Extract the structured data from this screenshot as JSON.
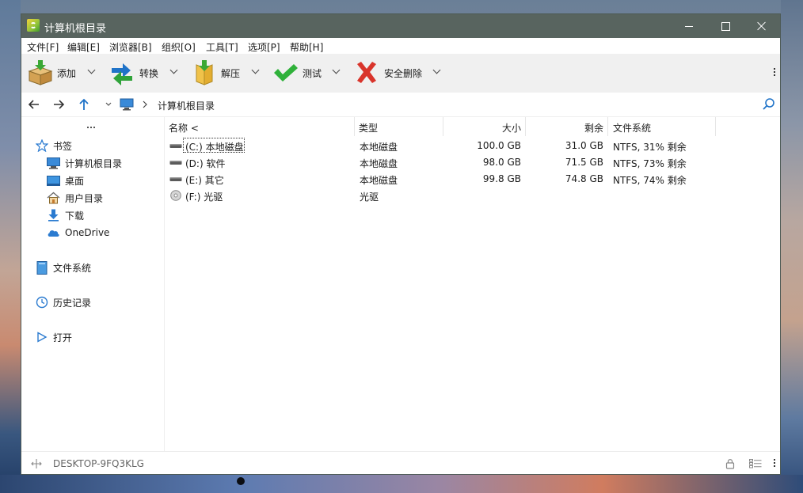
{
  "window": {
    "title": "计算机根目录"
  },
  "menu": [
    {
      "label": "文件[F]"
    },
    {
      "label": "编辑[E]"
    },
    {
      "label": "浏览器[B]"
    },
    {
      "label": "组织[O]"
    },
    {
      "label": "工具[T]"
    },
    {
      "label": "选项[P]"
    },
    {
      "label": "帮助[H]"
    }
  ],
  "toolbar": {
    "add": "添加",
    "convert": "转换",
    "extract": "解压",
    "test": "测试",
    "secure_delete": "安全删除"
  },
  "address": {
    "path": "计算机根目录"
  },
  "sidebar": {
    "bookmarks": "书签",
    "items": [
      {
        "label": "计算机根目录",
        "icon": "monitor-icon"
      },
      {
        "label": "桌面",
        "icon": "desktop-icon"
      },
      {
        "label": "用户目录",
        "icon": "home-icon"
      },
      {
        "label": "下载",
        "icon": "download-icon"
      },
      {
        "label": "OneDrive",
        "icon": "cloud-icon"
      }
    ],
    "filesystem": "文件系统",
    "history": "历史记录",
    "open": "打开"
  },
  "table": {
    "columns": {
      "name": "名称 <",
      "type": "类型",
      "size": "大小",
      "free": "剩余",
      "fs": "文件系统"
    },
    "rows": [
      {
        "name": "(C:) 本地磁盘",
        "type": "本地磁盘",
        "size": "100.0 GB",
        "free": "31.0 GB",
        "fs": "NTFS, 31% 剩余",
        "icon": "hard-drive-icon"
      },
      {
        "name": "(D:) 软件",
        "type": "本地磁盘",
        "size": "98.0 GB",
        "free": "71.5 GB",
        "fs": "NTFS, 73% 剩余",
        "icon": "hard-drive-icon"
      },
      {
        "name": "(E:) 其它",
        "type": "本地磁盘",
        "size": "99.8 GB",
        "free": "74.8 GB",
        "fs": "NTFS, 74% 剩余",
        "icon": "hard-drive-icon"
      },
      {
        "name": "(F:) 光驱",
        "type": "光驱",
        "size": "",
        "free": "",
        "fs": "",
        "icon": "optical-drive-icon"
      }
    ]
  },
  "status": {
    "computer": "DESKTOP-9FQ3KLG"
  },
  "colors": {
    "titlebar": "#58645f",
    "toolbar": "#f0f0f0",
    "accent": "#1f73c8"
  }
}
